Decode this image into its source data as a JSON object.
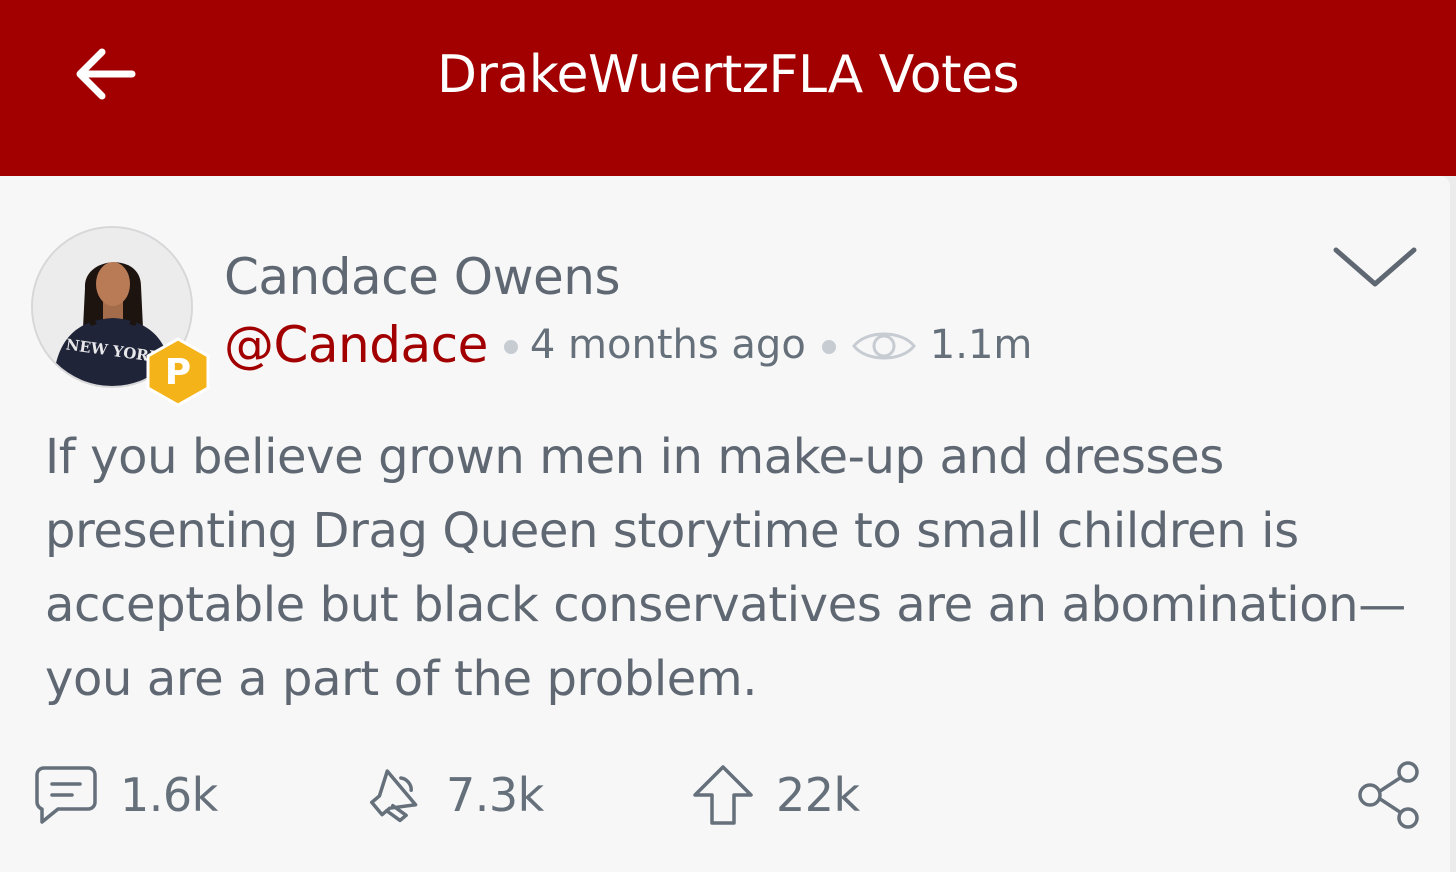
{
  "header": {
    "title": "DrakeWuertzFLA Votes"
  },
  "post": {
    "author_name": "Candace Owens",
    "handle": "@Candace",
    "time_ago": "4 months ago",
    "views": "1.1m",
    "body_lines": [
      "If you believe grown men in make-up and dresses",
      "presenting Drag Queen storytime to small children is",
      "acceptable but black conservatives are an abomination—",
      "you are a part of the problem."
    ],
    "avatar_shirt_text": "NEW YORK",
    "badge_letter": "P"
  },
  "actions": {
    "comments": "1.6k",
    "echoes": "7.3k",
    "upvotes": "22k"
  },
  "icons": {
    "back": "arrow-left-icon",
    "menu": "chevron-down-icon",
    "views": "eye-icon",
    "comments": "comment-icon",
    "echoes": "megaphone-icon",
    "upvotes": "arrow-up-icon",
    "share": "share-icon"
  },
  "colors": {
    "brand_red": "#a20000",
    "badge_yellow": "#f5b31a",
    "text_gray": "#5f6872",
    "background": "#f7f7f8"
  }
}
